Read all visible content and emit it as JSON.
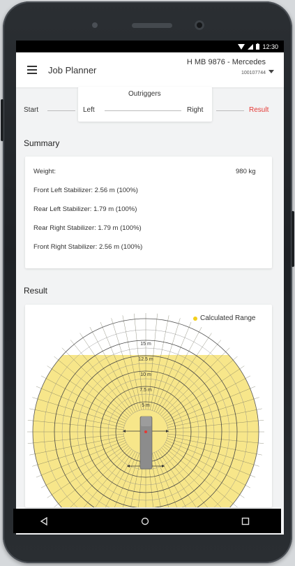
{
  "status": {
    "time": "12:30"
  },
  "appbar": {
    "title": "Job Planner",
    "vehicle_name": "H MB 9876 - Mercedes",
    "vehicle_id": "100107744"
  },
  "stepper": {
    "title": "Outriggers",
    "steps": [
      "Start",
      "Left",
      "Right",
      "Result"
    ]
  },
  "summary": {
    "title": "Summary",
    "weight_label": "Weight:",
    "weight_value": "980 kg",
    "rows": [
      "Front Left Stabilizer: 2.56 m (100%)",
      "Rear Left Stabilizer: 1.79 m (100%)",
      "Rear Right Stabilizer: 1.79 m (100%)",
      "Front Right Stabilizer: 2.56 m (100%)"
    ]
  },
  "result": {
    "title": "Result",
    "legend": "Calculated Range",
    "rings": [
      "15 m",
      "12.5 m",
      "10 m",
      "7.5 m",
      "5 m"
    ]
  },
  "colors": {
    "accent": "#e53935",
    "range_fill": "#f7e68a",
    "legend_dot": "#f2cf1e"
  },
  "icons": {
    "menu": "hamburger-icon",
    "dropdown": "chevron-down-icon",
    "back": "triangle-back-icon",
    "home": "circle-home-icon",
    "recent": "square-recent-icon"
  }
}
